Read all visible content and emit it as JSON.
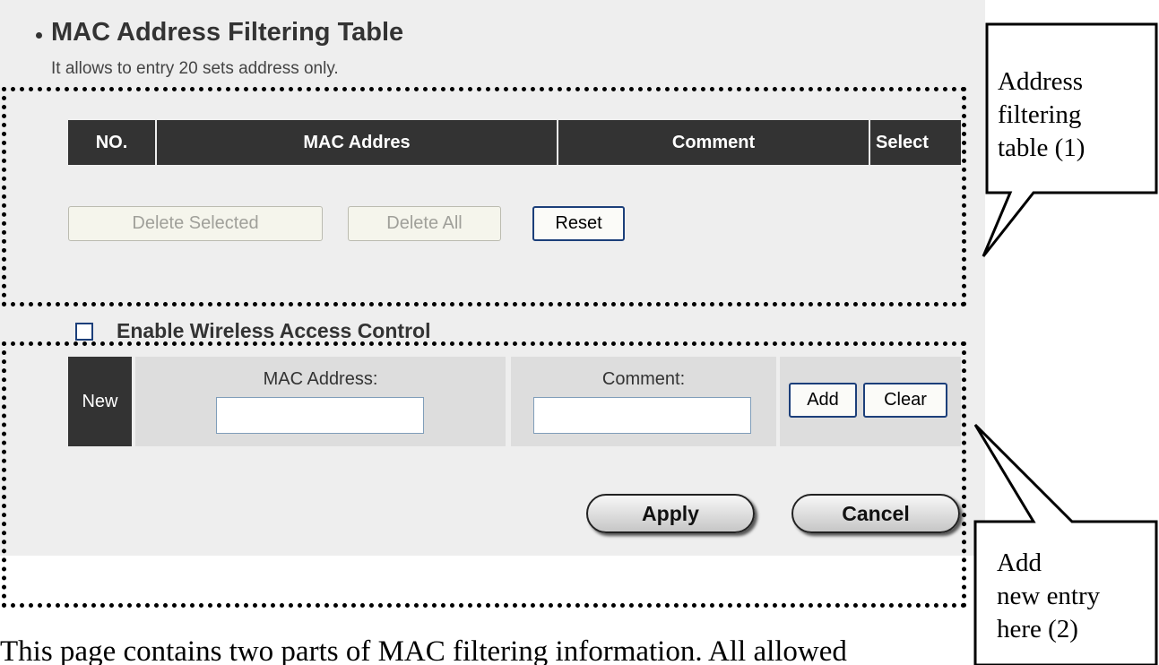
{
  "section": {
    "title": "MAC Address Filtering Table",
    "subtitle": "It allows to entry 20 sets address only."
  },
  "table": {
    "headers": [
      "NO.",
      "MAC Addres",
      "Comment",
      "Select"
    ]
  },
  "buttons": {
    "delete_selected": "Delete Selected",
    "delete_all": "Delete All",
    "reset": "Reset",
    "add": "Add",
    "clear": "Clear",
    "apply": "Apply",
    "cancel": "Cancel"
  },
  "access_control": {
    "label": "Enable Wireless Access Control",
    "checked": false
  },
  "new_entry": {
    "row_label": "New",
    "mac_label": "MAC Address:",
    "mac_value": "",
    "comment_label": "Comment:",
    "comment_value": ""
  },
  "callouts": {
    "callout1": [
      "Address",
      "filtering",
      "table (1)"
    ],
    "callout2": [
      "Add",
      "new entry",
      "here (2)"
    ]
  },
  "body_text": "This page contains two parts of MAC filtering information. All allowed"
}
